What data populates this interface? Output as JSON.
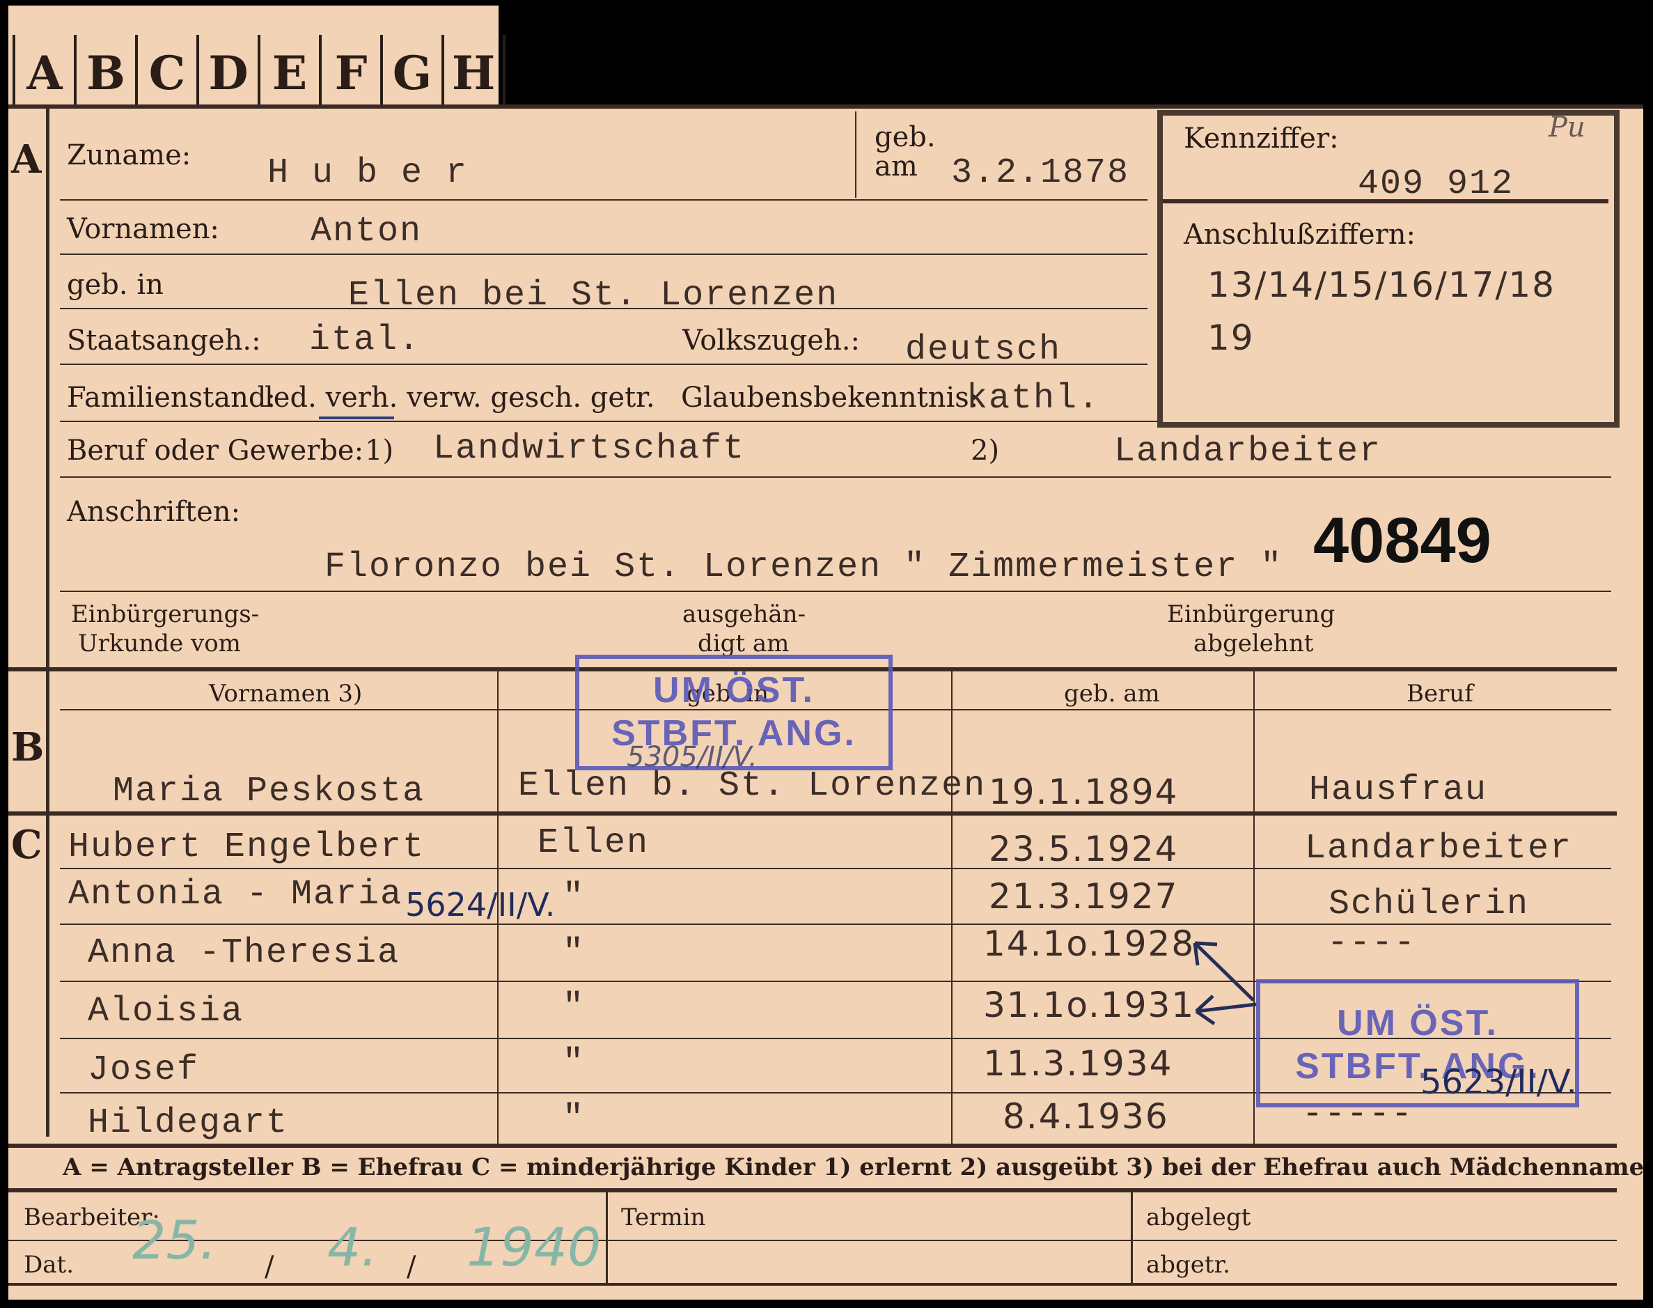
{
  "tabs": [
    "A",
    "B",
    "C",
    "D",
    "E",
    "F",
    "G",
    "H"
  ],
  "sections": {
    "a": "A",
    "b": "B",
    "c": "C"
  },
  "applicant": {
    "surname_label": "Zuname:",
    "surname": "H u b e r",
    "born_label": "geb.",
    "born_on_label": "am",
    "born_on": "3.2.1878",
    "firstnames_label": "Vornamen:",
    "firstnames": "Anton",
    "birthplace_label": "geb. in",
    "birthplace": "Ellen bei St. Lorenzen",
    "citizenship_label": "Staatsangeh.:",
    "citizenship": "ital.",
    "nationality_label": "Volkszugeh.:",
    "nationality": "deutsch",
    "marital_label": "Familienstand:",
    "marital_options": "led. verh. verw. gesch. getr.",
    "religion_label": "Glaubensbekenntnis:",
    "religion": "kathl.",
    "profession_label": "Beruf oder Gewerbe:",
    "note1": "1)",
    "profession_learned": "Landwirtschaft",
    "note2": "2)",
    "profession_practiced": "Landarbeiter",
    "addresses_label": "Anschriften:",
    "address": "Floronzo  bei St. Lorenzen \" Zimmermeister \"",
    "number": "40849",
    "naturalization_label_1": "Einbürgerungs-",
    "naturalization_label_2": "Urkunde vom",
    "handed_label_1": "ausgehän-",
    "handed_label_2": "digt am",
    "refused_label_1": "Einbürgerung",
    "refused_label_2": "abgelehnt"
  },
  "id_box": {
    "code_label": "Kennziffer:",
    "code": "409 912",
    "code_note": "Pu",
    "linked_label": "Anschlußziffern:",
    "linked_1": "13/14/15/16/17/18",
    "linked_2": "19"
  },
  "table_headers": {
    "firstnames": "Vornamen 3)",
    "born_in": "geb. in",
    "born_on": "geb. am",
    "profession": "Beruf"
  },
  "wife": {
    "name": "Maria Peskosta",
    "born_in": "Ellen b. St. Lorenzen",
    "born_on": "19.1.1894",
    "profession": "Hausfrau"
  },
  "children": [
    {
      "name": "Hubert Engelbert",
      "born_in": "Ellen",
      "born_on": "23.5.1924",
      "profession": "Landarbeiter"
    },
    {
      "name": "Antonia - Maria",
      "born_in": "\"",
      "born_on": "21.3.1927",
      "profession": "Schülerin"
    },
    {
      "name": "Anna -Theresia",
      "born_in": "\"",
      "born_on": "14.1o.1928",
      "profession": "----"
    },
    {
      "name": "Aloisia",
      "born_in": "\"",
      "born_on": "31.1o.1931",
      "profession": ""
    },
    {
      "name": "Josef",
      "born_in": "\"",
      "born_on": "11.3.1934",
      "profession": ""
    },
    {
      "name": "Hildegart",
      "born_in": "\"",
      "born_on": "8.4.1936",
      "profession": "-----"
    }
  ],
  "handwritten": {
    "antonia_ref": "5624/II/V.",
    "stamp2_ref": "5623/II/V.",
    "stamp1_ref": "5305/II/V."
  },
  "stamps": {
    "line1": "UM ÖST.",
    "line2": "STBFT. ANG."
  },
  "legend": "A = Antragsteller   B = Ehefrau   C = minderjährige Kinder   1) erlernt   2) ausgeübt   3) bei der Ehefrau auch Mädchenname",
  "footer": {
    "editor_label": "Bearbeiter:",
    "date_label": "Dat.",
    "date_d": "25.",
    "date_m": "4.",
    "date_y": "1940",
    "sep": "/",
    "term_label": "Termin",
    "filed_label": "abgelegt",
    "abgetr_label": "abgetr."
  },
  "colors": {
    "card": "#f3d3b6",
    "ink": "#2a1d17",
    "stamp": "#5a58b8",
    "pencil": "#86b6a6"
  }
}
